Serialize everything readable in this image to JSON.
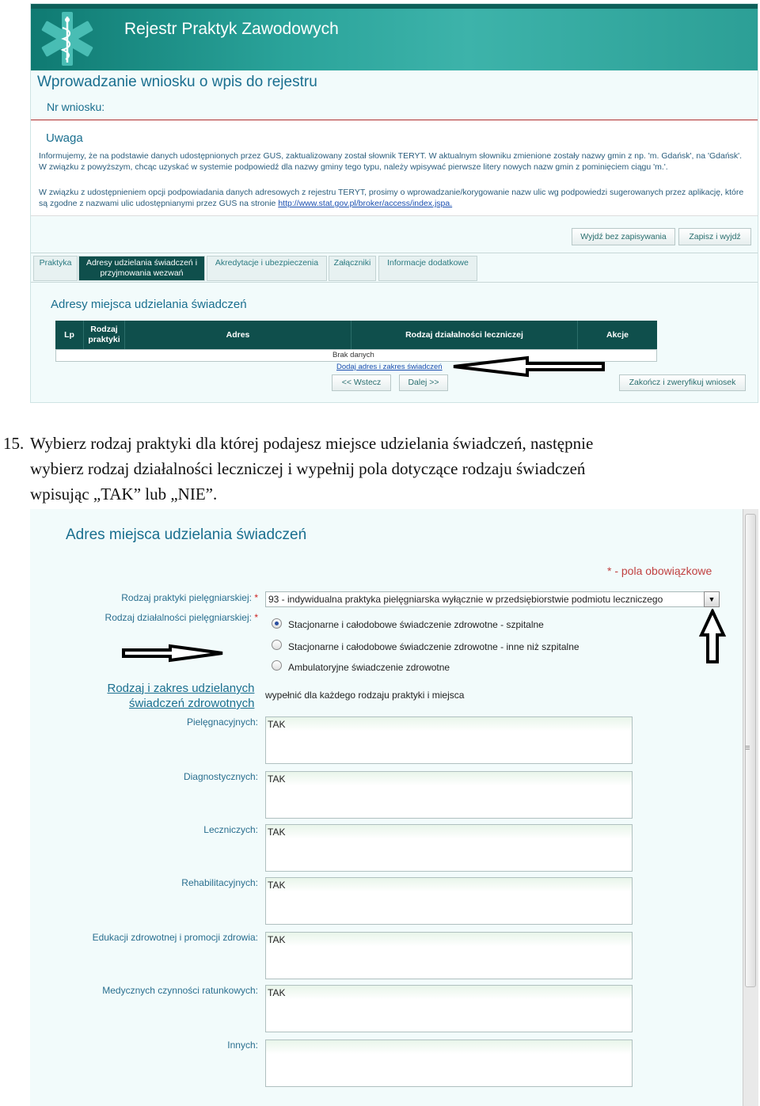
{
  "screen1": {
    "app_title": "Rejestr Praktyk Zawodowych",
    "page_title": "Wprowadzanie wniosku o wpis do rejestru",
    "nr_label": "Nr wniosku:",
    "notice": {
      "title": "Uwaga",
      "paragraph1": "Informujemy, że na podstawie danych udostępnionych przez GUS, zaktualizowany został słownik TERYT. W aktualnym słowniku zmienione zostały nazwy gmin z np. 'm. Gdańsk', na 'Gdańsk'. W związku z powyższym, chcąc uzyskać w systemie podpowiedź dla nazwy gminy tego typu, należy wpisywać pierwsze litery nowych nazw gmin z pominięciem ciągu 'm.'.",
      "paragraph2": "W związku z udostępnieniem opcji podpowiadania danych adresowych z rejestru TERYT, prosimy o wprowadzanie/korygowanie nazw ulic wg podpowiedzi sugerowanych przez aplikację, które są zgodne z nazwami ulic udostępnianymi przez GUS na stronie",
      "link": "http://www.stat.gov.pl/broker/access/index.jspa."
    },
    "buttons": {
      "exit": "Wyjdź bez zapisywania",
      "save_exit": "Zapisz i wyjdź",
      "back": "<< Wstecz",
      "next": "Dalej >>",
      "finish": "Zakończ i zweryfikuj wniosek"
    },
    "tabs": [
      "Praktyka",
      "Adresy udzielania świadczeń i przyjmowania wezwań",
      "Akredytacje i ubezpieczenia",
      "Załączniki",
      "Informacje dodatkowe"
    ],
    "section_title": "Adresy miejsca udzielania świadczeń",
    "table": {
      "columns": [
        "Lp",
        "Rodzaj praktyki",
        "Adres",
        "Rodzaj działalności leczniczej",
        "Akcje"
      ],
      "empty_text": "Brak danych",
      "add_link": "Dodaj adres i zakres świadczeń"
    }
  },
  "instruction": {
    "number": "15.",
    "line1": "Wybierz rodzaj praktyki dla której podajesz miejsce udzielania świadczeń, następnie",
    "line2": "wybierz rodzaj działalności leczniczej i wypełnij pola dotyczące rodzaju świadczeń",
    "line3": "wpisując „TAK” lub „NIE”."
  },
  "screen2": {
    "title": "Adres miejsca udzielania świadczeń",
    "required_note": "* - pola obowiązkowe",
    "practice_type_label": "Rodzaj praktyki pielęgniarskiej:",
    "practice_type_value": "93 - indywidualna praktyka pielęgniarska wyłącznie w przedsiębiorstwie podmiotu leczniczego",
    "activity_type_label": "Rodzaj działalności pielęgniarskiej:",
    "radio_options": [
      "Stacjonarne i całodobowe świadczenie zdrowotne - szpitalne",
      "Stacjonarne i całodobowe świadczenie zdrowotne - inne niż szpitalne",
      "Ambulatoryjne świadczenie zdrowotne"
    ],
    "selected_radio": 0,
    "section_link_line1": "Rodzaj i zakres udzielanych",
    "section_link_line2": "świadczeń zdrowotnych",
    "section_note": "wypełnić dla każdego rodzaju praktyki i miejsca",
    "fields": [
      {
        "label": "Pielęgnacyjnych:",
        "value": "TAK"
      },
      {
        "label": "Diagnostycznych:",
        "value": "TAK"
      },
      {
        "label": "Leczniczych:",
        "value": "TAK"
      },
      {
        "label": "Rehabilitacyjnych:",
        "value": "TAK"
      },
      {
        "label": "Edukacji zdrowotnej i promocji zdrowia:",
        "value": "TAK"
      },
      {
        "label": "Medycznych czynności ratunkowych:",
        "value": "TAK"
      },
      {
        "label": "Innych:",
        "value": ""
      }
    ]
  },
  "colors": {
    "header_teal": "#2aa39a",
    "dark_teal": "#0f4f4c",
    "label_blue": "#1a6f8f",
    "required_red": "#c04040"
  }
}
